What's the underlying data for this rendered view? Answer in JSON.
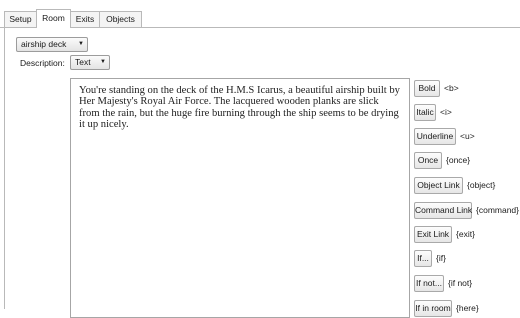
{
  "tabs": [
    "Setup",
    "Room",
    "Exits",
    "Objects"
  ],
  "active_tab": "Room",
  "room_select": {
    "value": "airship deck"
  },
  "description": {
    "label": "Description:",
    "mode_value": "Text",
    "text": "You're standing on the deck of the H.M.S Icarus, a beautiful airship built by Her Majesty's Royal Air Force. The lacquered wooden planks are slick from the rain, but the huge fire burning through the ship seems to be drying it up nicely."
  },
  "format_buttons": [
    {
      "label": "Bold",
      "tag": "<b>"
    },
    {
      "label": "Italic",
      "tag": "<i>"
    },
    {
      "label": "Underline",
      "tag": "<u>"
    },
    {
      "label": "Once",
      "tag": "{once}"
    },
    {
      "label": "Object Link",
      "tag": "{object}"
    },
    {
      "label": "Command Link",
      "tag": "{command}"
    },
    {
      "label": "Exit Link",
      "tag": "{exit}"
    },
    {
      "label": "If...",
      "tag": "{if}"
    },
    {
      "label": "If not...",
      "tag": "{if not}"
    },
    {
      "label": "If in room",
      "tag": "{here}"
    }
  ],
  "icons": {
    "dropdown": "chevron-down-icon"
  }
}
